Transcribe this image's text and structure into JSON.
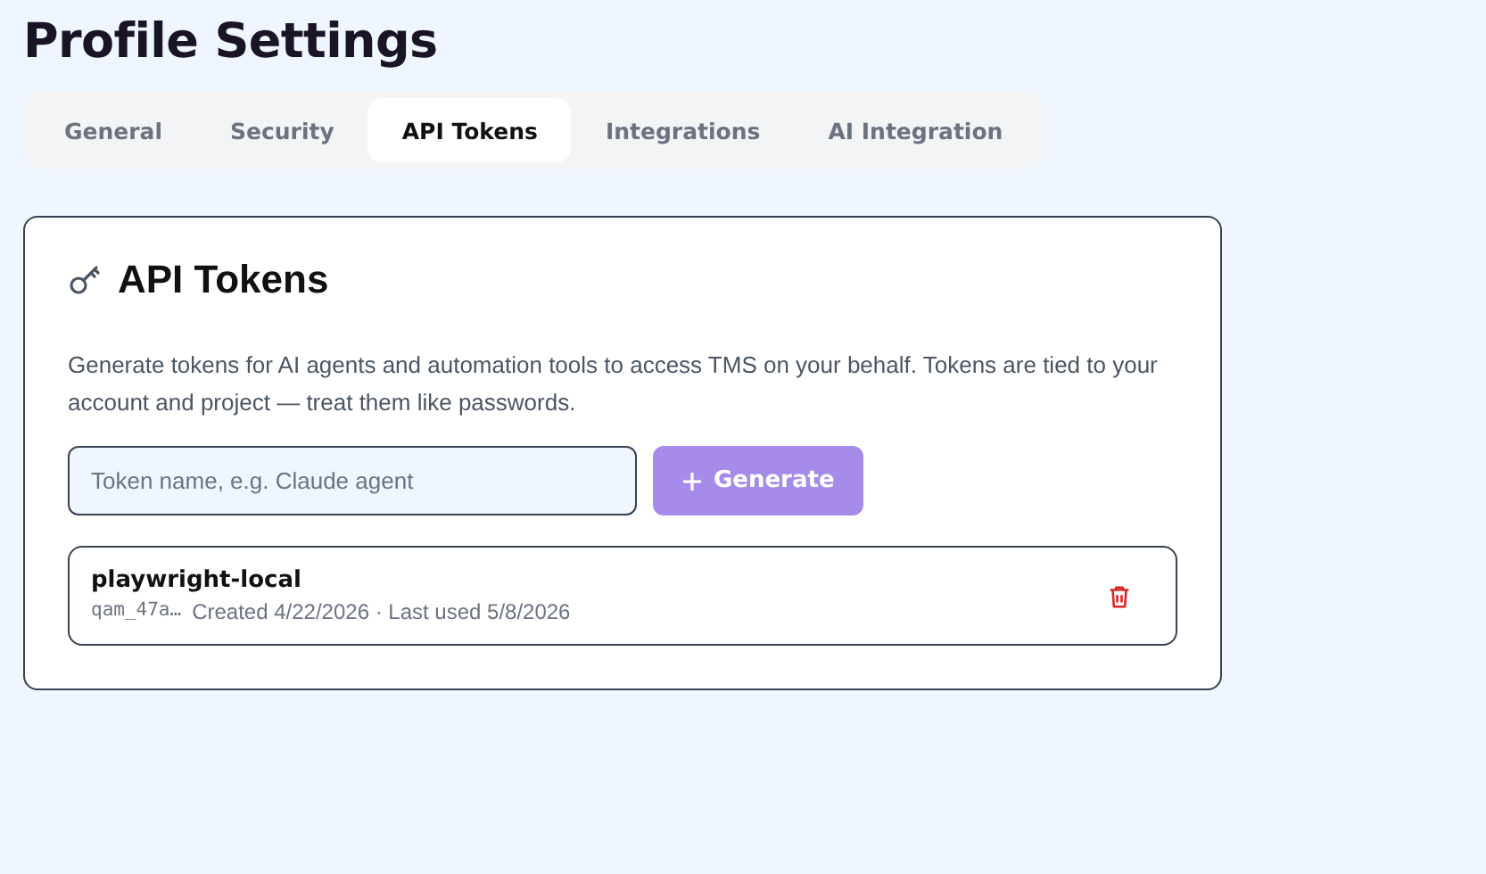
{
  "page_title": "Profile Settings",
  "tabs": [
    {
      "label": "General",
      "selected": false
    },
    {
      "label": "Security",
      "selected": false
    },
    {
      "label": "API Tokens",
      "selected": true
    },
    {
      "label": "Integrations",
      "selected": false
    },
    {
      "label": "AI Integration",
      "selected": false
    }
  ],
  "card": {
    "title": "API Tokens",
    "description": "Generate tokens for AI agents and automation tools to access TMS on your behalf. Tokens are tied to your account and project — treat them like passwords.",
    "name_field": {
      "placeholder": "Token name, e.g. Claude agent"
    },
    "generate_button": {
      "label": "Generate",
      "disabled": true
    },
    "tokens": [
      {
        "name": "playwright-local",
        "prefix": "qam_47a…",
        "meta": "Created 4/22/2026 · Last used 5/8/2026"
      }
    ]
  }
}
